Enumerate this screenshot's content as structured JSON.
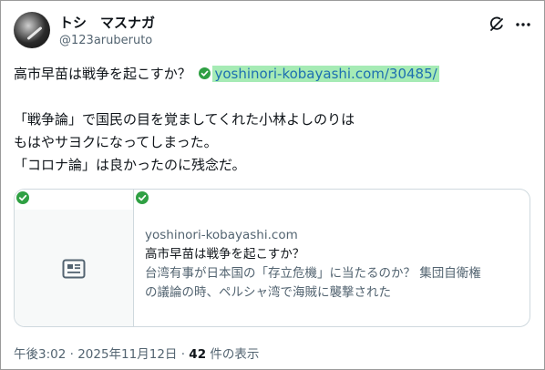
{
  "user": {
    "display_name": "トシ　マスナガ",
    "handle": "@123aruberuto"
  },
  "header": {
    "grok_icon": "grok-icon",
    "more_icon": "more-dots-icon"
  },
  "tweet": {
    "line1_text": "高市早苗は戦争を起こすか？",
    "link_text": "yoshinori-kobayashi.com/30485/",
    "line3": "「戦争論」で国民の目を覚ましてくれた小林よしのりは",
    "line4": "もはやサヨクになってしまった。",
    "line5": "「コロナ論」は良かったのに残念だ。"
  },
  "card": {
    "domain": "yoshinori-kobayashi.com",
    "title": "高市早苗は戦争を起こすか？",
    "desc_line1": "台湾有事が日本国の「存立危機」に当たるのか？ 集団自衛権",
    "desc_line2": "の議論の時、ペルシャ湾で海賊に襲撃された",
    "thumb_icon": "news-article-icon"
  },
  "meta": {
    "time": "午後3:02",
    "separator": " · ",
    "date": "2025年11月12日",
    "views_count": "42",
    "views_label": " 件の表示"
  },
  "colors": {
    "link": "#1d6fb0",
    "link_highlight": "#a6ebb5",
    "check_green": "#2fa043",
    "secondary_text": "#536471",
    "border": "#cfd9de"
  }
}
